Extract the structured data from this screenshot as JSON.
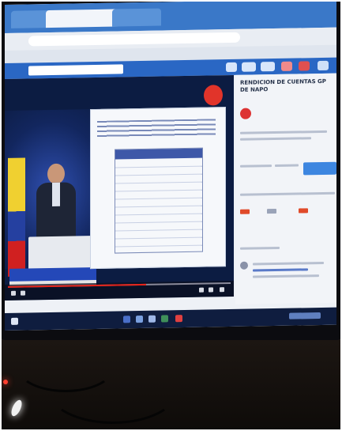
{
  "image": {
    "scene": "photo of a computer monitor showing a browser with a live-streamed video"
  },
  "browser": {
    "tabs": [
      {
        "label": ""
      },
      {
        "label": ""
      },
      {
        "label": ""
      }
    ],
    "url": "",
    "bookmarks_label": ""
  },
  "video_page": {
    "title": "RENDICION DE CUENTAS GP DE NAPO",
    "channel": "",
    "progress_fraction": 0.62
  },
  "colors": {
    "screen_blue": "#2a67c4",
    "video_bg": "#0c1c42",
    "accent_red": "#e1342a"
  }
}
